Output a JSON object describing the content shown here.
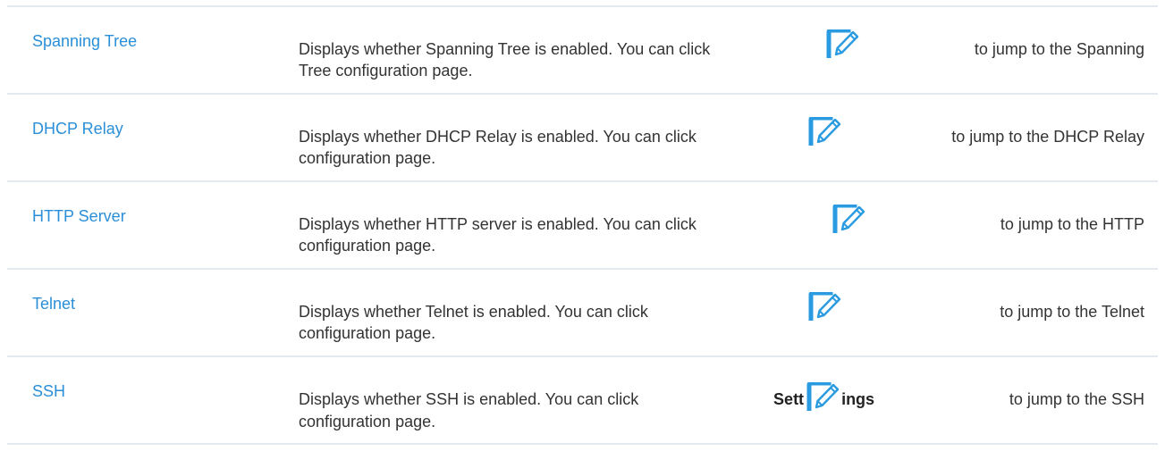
{
  "rows": [
    {
      "param": "Spanning Tree",
      "desc_pre": "Displays whether Spanning Tree is enabled. You can click",
      "desc_post": "to jump to the Spanning",
      "desc_line2": "Tree configuration page."
    },
    {
      "param": "DHCP Relay",
      "desc_pre": "Displays whether DHCP Relay is enabled. You can click",
      "desc_post": "to jump to the DHCP Relay",
      "desc_line2": "configuration page."
    },
    {
      "param": "HTTP Server",
      "desc_pre": "Displays whether HTTP server is enabled. You can click",
      "desc_post": "to jump to the HTTP",
      "desc_line2": "configuration page."
    },
    {
      "param": "Telnet",
      "desc_pre": "Displays whether Telnet is enabled. You can click",
      "desc_post": "to jump to the Telnet",
      "desc_line2": "configuration page."
    },
    {
      "param": "SSH",
      "desc_pre": "Displays whether SSH is enabled. You can click",
      "desc_bold_a": "Sett",
      "desc_bold_b": "ings",
      "desc_post": "to jump to the SSH",
      "desc_line2": "configuration page."
    }
  ],
  "icon_name": "edit-icon",
  "colors": {
    "param_text": "#2a8fd8",
    "icon": "#2a9be0",
    "divider": "#e3e9ef"
  }
}
